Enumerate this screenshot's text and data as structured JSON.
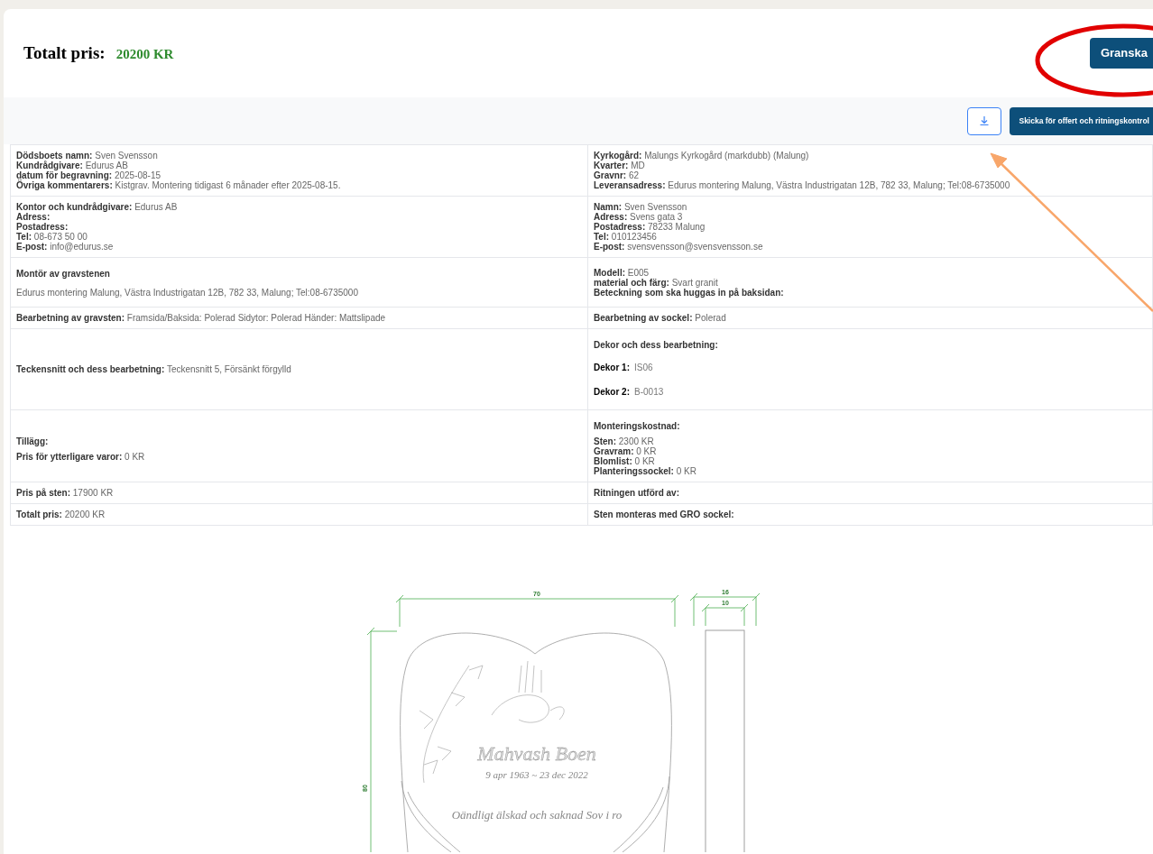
{
  "header": {
    "label": "Totalt pris:",
    "value": "20200 KR",
    "review_button": "Granska"
  },
  "toolbar": {
    "send_button": "Skicka för offert och ritningskontrol"
  },
  "rows": [
    {
      "left": [
        {
          "kind": "field",
          "label": "Dödsboets namn:",
          "value": "Sven Svensson"
        },
        {
          "kind": "field",
          "label": "Kundrådgivare:",
          "value": "Edurus AB"
        },
        {
          "kind": "field",
          "label": "datum för begravning:",
          "value": "2025-08-15"
        },
        {
          "kind": "field",
          "label": "Övriga kommentarers:",
          "value": "Kistgrav. Montering tidigast 6 månader efter 2025-08-15."
        }
      ],
      "right": [
        {
          "kind": "field",
          "label": "Kyrkogård:",
          "value": "Malungs Kyrkogård (markdubb) (Malung)"
        },
        {
          "kind": "field",
          "label": "Kvarter:",
          "value": "MD"
        },
        {
          "kind": "field",
          "label": "Gravnr:",
          "value": "62"
        },
        {
          "kind": "field",
          "label": "Leveransadress:",
          "value": "Edurus montering Malung, Västra Industrigatan 12B, 782 33, Malung; Tel:08-6735000"
        }
      ]
    },
    {
      "left": [
        {
          "kind": "field",
          "label": "Kontor och kundrådgivare:",
          "value": "Edurus AB"
        },
        {
          "kind": "field",
          "label": "Adress:"
        },
        {
          "kind": "field",
          "label": "Postadress:"
        },
        {
          "kind": "field",
          "label": "Tel:",
          "value": "08-673 50 00"
        },
        {
          "kind": "field",
          "label": "E-post:",
          "value": "info@edurus.se"
        }
      ],
      "right": [
        {
          "kind": "field",
          "label": "Namn:",
          "value": "Sven Svensson"
        },
        {
          "kind": "field",
          "label": "Adress:",
          "value": "Svens gata 3"
        },
        {
          "kind": "field",
          "label": "Postadress:",
          "value": "78233 Malung"
        },
        {
          "kind": "field",
          "label": "Tel:",
          "value": "010123456"
        },
        {
          "kind": "field",
          "label": "E-post:",
          "value": "svensvensson@svensvensson.se"
        }
      ]
    },
    {
      "left": [
        {
          "kind": "heading",
          "label": "Montör av gravstenen"
        },
        {
          "kind": "text",
          "value": "Edurus montering Malung, Västra Industrigatan 12B, 782 33, Malung; Tel:08-6735000"
        }
      ],
      "right": [
        {
          "kind": "field",
          "label": "Modell:",
          "value": "E005"
        },
        {
          "kind": "field",
          "label": "material och färg:",
          "value": "Svart granit"
        },
        {
          "kind": "field",
          "label": "Beteckning som ska huggas in på baksidan:"
        }
      ]
    },
    {
      "left": [
        {
          "kind": "field",
          "label": "Bearbetning av gravsten:",
          "value": "Framsida/Baksida: Polerad Sidytor: Polerad Händer: Mattslipade"
        }
      ],
      "right": [
        {
          "kind": "field",
          "label": "Bearbetning av sockel:",
          "value": "Polerad"
        }
      ]
    },
    {
      "left": [
        {
          "kind": "field",
          "label": "Teckensnitt och dess bearbetning:",
          "value": "Teckensnitt 5, Försänkt förgylld"
        }
      ],
      "right": [
        {
          "kind": "heading",
          "label": "Dekor och dess bearbetning:"
        },
        {
          "kind": "dekor",
          "label": "Dekor 1:",
          "value": "IS06"
        },
        {
          "kind": "dekor",
          "label": "Dekor 2:",
          "value": "B-0013"
        }
      ]
    },
    {
      "left": [
        {
          "kind": "heading",
          "label": "Tillägg:"
        },
        {
          "kind": "field",
          "label": "Pris för ytterligare varor:",
          "value": "0 KR"
        }
      ],
      "right": [
        {
          "kind": "heading",
          "label": "Monteringskostnad:"
        },
        {
          "kind": "field",
          "label": "Sten:",
          "value": "2300 KR"
        },
        {
          "kind": "field",
          "label": "Gravram:",
          "value": "0 KR"
        },
        {
          "kind": "field",
          "label": "Blomlist:",
          "value": "0 KR"
        },
        {
          "kind": "field",
          "label": "Planteringssockel:",
          "value": "0 KR"
        }
      ]
    },
    {
      "left": [
        {
          "kind": "field",
          "label": "Pris på sten:",
          "value": "17900 KR"
        }
      ],
      "right": [
        {
          "kind": "field",
          "label": "Ritningen utförd av:"
        }
      ]
    },
    {
      "left": [
        {
          "kind": "field",
          "label": "Totalt pris:",
          "value": "20200 KR"
        }
      ],
      "right": [
        {
          "kind": "field",
          "label": "Sten monteras med GRO sockel:"
        }
      ]
    }
  ],
  "drawing": {
    "width_label": "70",
    "height_label": "80",
    "depth_outer_label": "16",
    "depth_inner_label": "10",
    "name": "Mahvash Boen",
    "dates": "9 apr 1963 ~ 23 dec 2022",
    "epitaph": "Oändligt älskad och saknad Sov i ro"
  }
}
